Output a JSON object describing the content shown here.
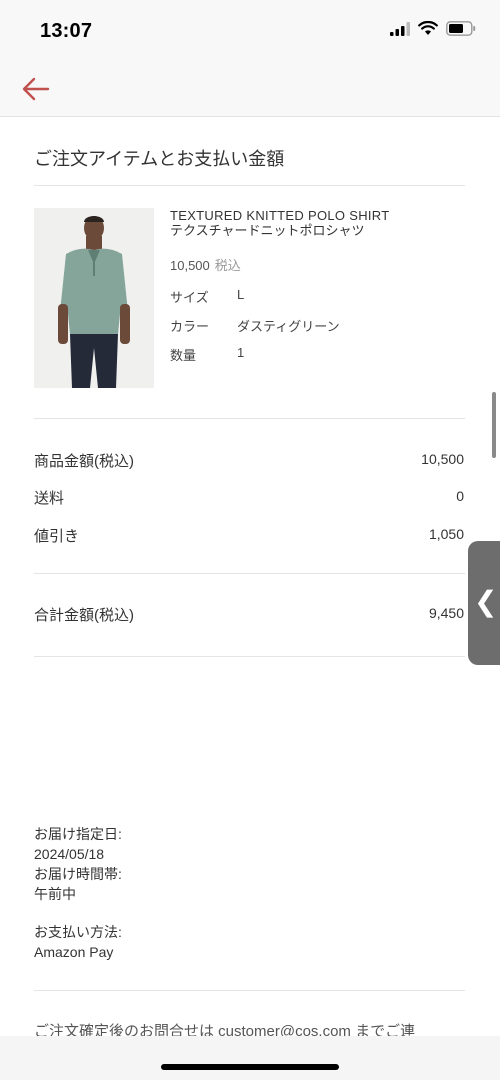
{
  "status": {
    "time": "13:07"
  },
  "section_title": "ご注文アイテムとお支払い金額",
  "product": {
    "name_en": "TEXTURED KNITTED POLO SHIRT",
    "name_ja": "テクスチャードニットポロシャツ",
    "price": "10,500",
    "tax_label": "税込",
    "attributes": [
      {
        "label": "サイズ",
        "value": "L"
      },
      {
        "label": "カラー",
        "value": "ダスティグリーン"
      },
      {
        "label": "数量",
        "value": "1"
      }
    ]
  },
  "summary": {
    "rows": [
      {
        "label": "商品金額(税込)",
        "value": "10,500"
      },
      {
        "label": "送料",
        "value": "0"
      },
      {
        "label": "値引き",
        "value": "1,050"
      }
    ],
    "total": {
      "label": "合計金額(税込)",
      "value": "9,450"
    }
  },
  "delivery": {
    "date_label": "お届け指定日:",
    "date_value": "2024/05/18",
    "time_label": "お届け時間帯:",
    "time_value": "午前中"
  },
  "payment": {
    "label": "お支払い方法:",
    "value": "Amazon Pay"
  },
  "footer_text": "ご注文確定後のお問合せは customer@cos.com までご連",
  "side_tab_glyph": "❮",
  "colors": {
    "accent": "#c0504d"
  }
}
